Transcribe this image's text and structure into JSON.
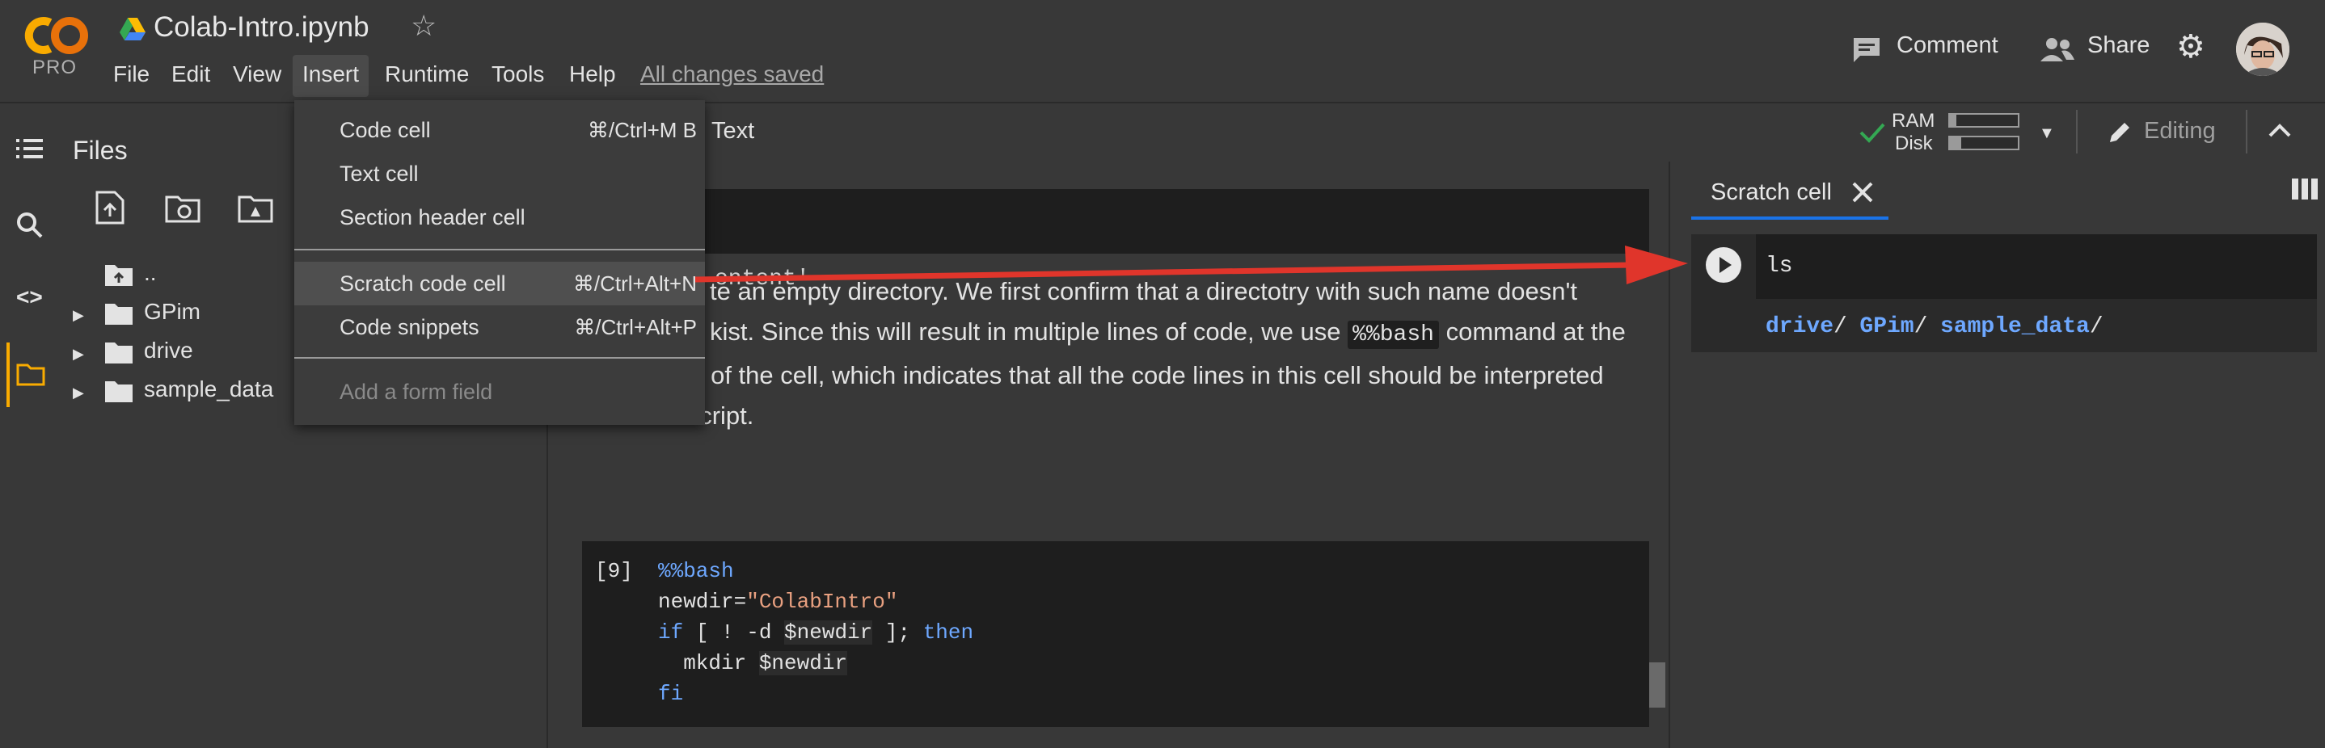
{
  "header": {
    "brand_badge": "PRO",
    "notebook_title": "Colab-Intro.ipynb",
    "menus": [
      "File",
      "Edit",
      "View",
      "Insert",
      "Runtime",
      "Tools",
      "Help"
    ],
    "save_status": "All changes saved",
    "comment_label": "Comment",
    "share_label": "Share"
  },
  "sidebar": {
    "title": "Files",
    "tree": [
      {
        "label": ".."
      },
      {
        "label": "GPim"
      },
      {
        "label": "drive"
      },
      {
        "label": "sample_data"
      }
    ]
  },
  "toolbar": {
    "text_button": "Text",
    "ram_label": "RAM",
    "disk_label": "Disk",
    "editing_label": "Editing"
  },
  "insert_menu": {
    "items": [
      {
        "label": "Code cell",
        "shortcut": "⌘/Ctrl+M B"
      },
      {
        "label": "Text cell",
        "shortcut": ""
      },
      {
        "label": "Section header cell",
        "shortcut": ""
      },
      {
        "label": "Scratch code cell",
        "shortcut": "⌘/Ctrl+Alt+N"
      },
      {
        "label": "Code snippets",
        "shortcut": "⌘/Ctrl+Alt+P"
      },
      {
        "label": "Add a form field",
        "shortcut": ""
      }
    ]
  },
  "notebook": {
    "content_fragment": "ontent'",
    "text_line1": "te an empty directory. We first confirm that a directotry with such name doesn't",
    "text_line2a": "kist. Since this will result in multiple lines of code, we use",
    "inline_code": "%%bash",
    "text_line2b": "command at the",
    "text_line3": "beginning of the cell, which indicates that all the code lines in this cell should be interpreted",
    "text_line4": "as shell script.",
    "code_cell": {
      "exec_count": "[9]",
      "magic": "%%bash",
      "line2_var": "newdir=",
      "line2_str": "\"ColabIntro\"",
      "line3_if": "if",
      "line3_mid1": " [ ! -d ",
      "line3_var": "$newdir",
      "line3_mid2": " ]; ",
      "line3_then": "then",
      "line4_cmd": "  mkdir ",
      "line4_var": "$newdir",
      "line5_fi": "fi"
    }
  },
  "scratch": {
    "tab_label": "Scratch cell",
    "code": "ls",
    "output": [
      {
        "name": "drive",
        "sep": "/"
      },
      {
        "name": "GPim",
        "sep": "/"
      },
      {
        "name": "sample_data",
        "sep": "/"
      }
    ]
  },
  "colors": {
    "accent_blue": "#1a73e8",
    "arrow_red": "#e0352b",
    "logo_orange": "#f9ab00"
  }
}
